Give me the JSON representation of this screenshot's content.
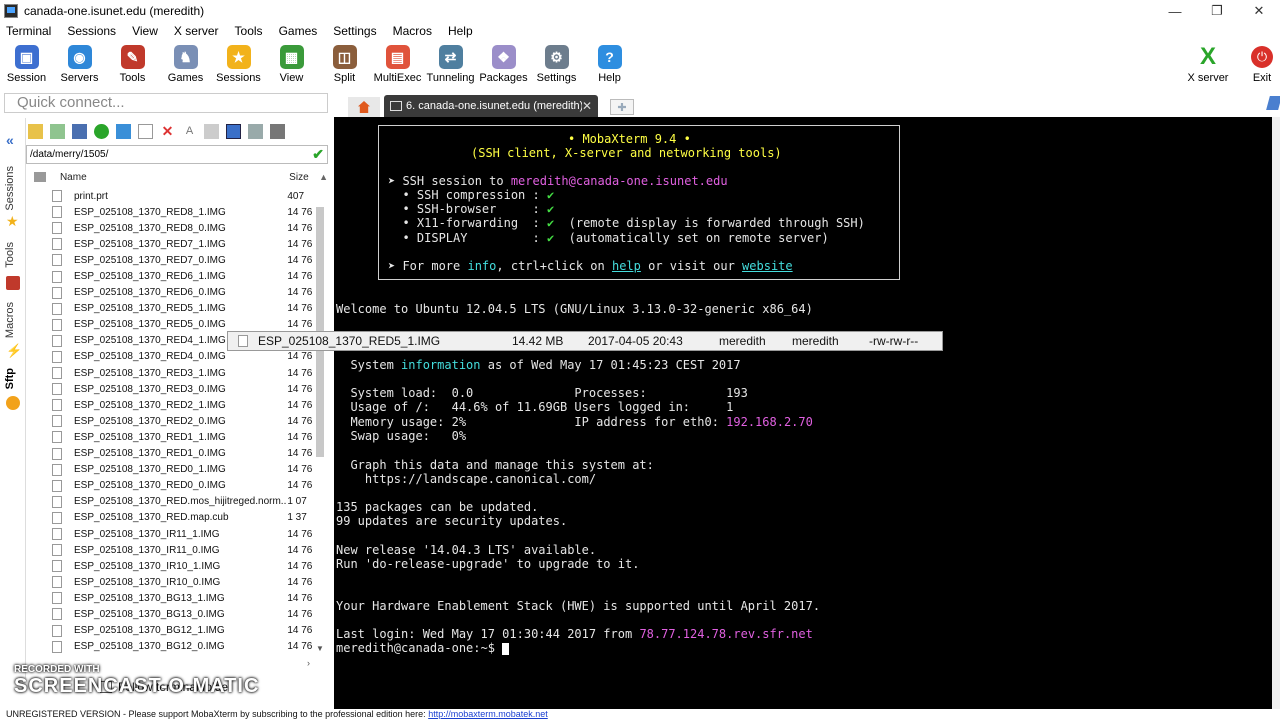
{
  "window": {
    "title": "canada-one.isunet.edu (meredith)",
    "controls": [
      "—",
      "❐",
      "✕"
    ]
  },
  "menu": [
    "Terminal",
    "Sessions",
    "View",
    "X server",
    "Tools",
    "Games",
    "Settings",
    "Macros",
    "Help"
  ],
  "toolbar": {
    "buttons": [
      {
        "label": "Session",
        "icon": "session-icon",
        "color": "#3d6fd0"
      },
      {
        "label": "Servers",
        "icon": "servers-icon",
        "color": "#2e87d8"
      },
      {
        "label": "Tools",
        "icon": "tools-icon",
        "color": "#c0392b"
      },
      {
        "label": "Games",
        "icon": "games-icon",
        "color": "#7a8fb5"
      },
      {
        "label": "Sessions",
        "icon": "star-icon",
        "color": "#f2b21b"
      },
      {
        "label": "View",
        "icon": "view-icon",
        "color": "#3a9a3a"
      },
      {
        "label": "Split",
        "icon": "split-icon",
        "color": "#8b5e3c"
      },
      {
        "label": "MultiExec",
        "icon": "multiexec-icon",
        "color": "#e0533b"
      },
      {
        "label": "Tunneling",
        "icon": "tunneling-icon",
        "color": "#4f7f9f"
      },
      {
        "label": "Packages",
        "icon": "packages-icon",
        "color": "#9b8ec9"
      },
      {
        "label": "Settings",
        "icon": "settings-icon",
        "color": "#6d7d8d"
      },
      {
        "label": "Help",
        "icon": "help-icon",
        "color": "#2e8ee0"
      }
    ],
    "xserver_label": "X server",
    "exit_label": "Exit"
  },
  "quick_connect": {
    "placeholder": "Quick connect..."
  },
  "tabs": {
    "session_tab_label": "6. canada-one.isunet.edu (meredith)",
    "close_glyph": "✕",
    "new_tab_glyph": "✚"
  },
  "sidetabs": [
    "Sessions",
    "Tools",
    "Macros",
    "Sftp"
  ],
  "file_browser": {
    "path": "/data/merry/1505/",
    "columns": {
      "name": "Name",
      "size": "Size"
    },
    "files": [
      {
        "name": "print.prt",
        "size": "407"
      },
      {
        "name": "ESP_025108_1370_RED8_1.IMG",
        "size": "14 76"
      },
      {
        "name": "ESP_025108_1370_RED8_0.IMG",
        "size": "14 76"
      },
      {
        "name": "ESP_025108_1370_RED7_1.IMG",
        "size": "14 76"
      },
      {
        "name": "ESP_025108_1370_RED7_0.IMG",
        "size": "14 76"
      },
      {
        "name": "ESP_025108_1370_RED6_1.IMG",
        "size": "14 76"
      },
      {
        "name": "ESP_025108_1370_RED6_0.IMG",
        "size": "14 76"
      },
      {
        "name": "ESP_025108_1370_RED5_1.IMG",
        "size": "14 76"
      },
      {
        "name": "ESP_025108_1370_RED5_0.IMG",
        "size": "14 76"
      },
      {
        "name": "ESP_025108_1370_RED4_1.IMG",
        "size": "14 76"
      },
      {
        "name": "ESP_025108_1370_RED4_0.IMG",
        "size": "14 76"
      },
      {
        "name": "ESP_025108_1370_RED3_1.IMG",
        "size": "14 76"
      },
      {
        "name": "ESP_025108_1370_RED3_0.IMG",
        "size": "14 76"
      },
      {
        "name": "ESP_025108_1370_RED2_1.IMG",
        "size": "14 76"
      },
      {
        "name": "ESP_025108_1370_RED2_0.IMG",
        "size": "14 76"
      },
      {
        "name": "ESP_025108_1370_RED1_1.IMG",
        "size": "14 76"
      },
      {
        "name": "ESP_025108_1370_RED1_0.IMG",
        "size": "14 76"
      },
      {
        "name": "ESP_025108_1370_RED0_1.IMG",
        "size": "14 76"
      },
      {
        "name": "ESP_025108_1370_RED0_0.IMG",
        "size": "14 76"
      },
      {
        "name": "ESP_025108_1370_RED.mos_hijitreged.norm...",
        "size": "1 07"
      },
      {
        "name": "ESP_025108_1370_RED.map.cub",
        "size": "1 37"
      },
      {
        "name": "ESP_025108_1370_IR11_1.IMG",
        "size": "14 76"
      },
      {
        "name": "ESP_025108_1370_IR11_0.IMG",
        "size": "14 76"
      },
      {
        "name": "ESP_025108_1370_IR10_1.IMG",
        "size": "14 76"
      },
      {
        "name": "ESP_025108_1370_IR10_0.IMG",
        "size": "14 76"
      },
      {
        "name": "ESP_025108_1370_BG13_1.IMG",
        "size": "14 76"
      },
      {
        "name": "ESP_025108_1370_BG13_0.IMG",
        "size": "14 76"
      },
      {
        "name": "ESP_025108_1370_BG12_1.IMG",
        "size": "14 76"
      },
      {
        "name": "ESP_025108_1370_BG12_0.IMG",
        "size": "14 76"
      }
    ],
    "follow_label": "Follow terminal folder"
  },
  "tooltip": {
    "name": "ESP_025108_1370_RED5_1.IMG",
    "size": "14.42 MB",
    "date": "2017-04-05 20:43",
    "owner": "meredith",
    "group": "meredith",
    "perms": "-rw-rw-r--"
  },
  "terminal": {
    "banner": {
      "title": "• MobaXterm 9.4 •",
      "subtitle": "(SSH client, X-server and networking tools)",
      "ssh_prefix": "➤ SSH session to ",
      "user": "meredith",
      "at_host": "@canada-one.isunet.edu",
      "rows": [
        {
          "label": "  • SSH compression : ",
          "mark": "✔",
          "note": ""
        },
        {
          "label": "  • SSH-browser     : ",
          "mark": "✔",
          "note": ""
        },
        {
          "label": "  • X11-forwarding  : ",
          "mark": "✔",
          "note": "  (remote display is forwarded through SSH)"
        },
        {
          "label": "  • DISPLAY         : ",
          "mark": "✔",
          "note": "  (automatically set on remote server)"
        }
      ],
      "more_prefix": "➤ For more ",
      "info": "info",
      "more_mid": ", ctrl+click on ",
      "help": "help",
      "more_mid2": " or visit our ",
      "website": "website"
    },
    "welcome": "Welcome to Ubuntu 12.04.5 LTS (GNU/Linux 3.13.0-32-generic x86_64)",
    "sysinfo_prefix": "  System ",
    "sysinfo_word": "information",
    "sysinfo_suffix": " as of Wed May 17 01:45:23 CEST 2017",
    "stats": [
      {
        "left": "  System load:  0.0              ",
        "right_label": "Processes:           ",
        "right_value": "193",
        "color": ""
      },
      {
        "left": "  Usage of /:   44.6% of 11.69GB ",
        "right_label": "Users logged in:     ",
        "right_value": "1",
        "color": ""
      },
      {
        "left": "  Memory usage: 2%               ",
        "right_label": "IP address for eth0: ",
        "right_value": "192.168.2.70",
        "color": "m"
      },
      {
        "left": "  Swap usage:   0%",
        "right_label": "",
        "right_value": "",
        "color": ""
      }
    ],
    "graph_line": "  Graph this data and manage this system at:",
    "graph_url": "    https://landscape.canonical.com/",
    "packages_line": "135 packages can be updated.",
    "security_line": "99 updates are security updates.",
    "release_line": "New release '14.04.3 LTS' available.",
    "upgrade_line": "Run 'do-release-upgrade' to upgrade to it.",
    "hwe_line": "Your Hardware Enablement Stack (HWE) is supported until April 2017.",
    "last_login_prefix": "Last login: Wed May 17 01:30:44 2017 from ",
    "last_login_ip": "78.77.124.78",
    "last_login_suffix": ".rev.sfr.net",
    "prompt": "meredith@canada-one:~$ "
  },
  "statusbar": {
    "text": "UNREGISTERED VERSION  -  Please support MobaXterm by subscribing to the professional edition here: ",
    "link": "http://mobaxterm.mobatek.net"
  },
  "watermark": {
    "line1": "RECORDED WITH",
    "line2": "SCREENCAST-O-MATIC"
  }
}
